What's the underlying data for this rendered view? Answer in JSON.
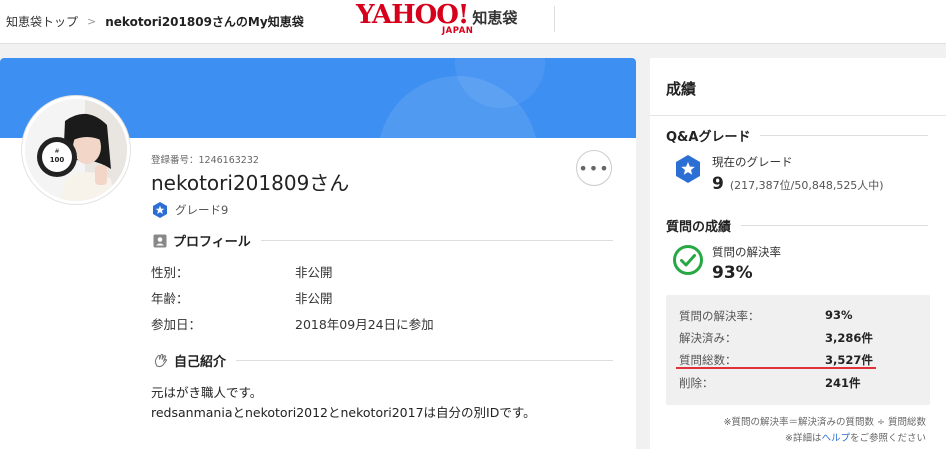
{
  "breadcrumb": {
    "top": "知恵袋トップ",
    "separator": ">",
    "current": "nekotori201809さんのMy知恵袋"
  },
  "logo": {
    "yahoo": "YAHOO!",
    "japan": "JAPAN",
    "service": "知恵袋",
    "brand_color": "#d7001c"
  },
  "profile": {
    "registration_label": "登録番号：1246163232",
    "username": "nekotori201809さん",
    "grade": "グレード9",
    "more_label": "•••",
    "avatar_icon": "avatar-photo",
    "banner_color": "#3d8ff1"
  },
  "profile_section": {
    "title": "プロフィール",
    "rows": [
      {
        "label": "性別：",
        "value": "非公開"
      },
      {
        "label": "年齢：",
        "value": "非公開"
      },
      {
        "label": "参加日：",
        "value": "2018年09月24日に参加"
      }
    ]
  },
  "intro_section": {
    "title": "自己紹介",
    "lines": [
      "元はがき職人です。",
      "redsanmaniaとnekotori2012とnekotori2017は自分の別IDです。"
    ]
  },
  "sidebar": {
    "title": "成績",
    "qa_grade": {
      "heading": "Q&Aグレード",
      "current_label": "現在のグレード",
      "value": "9",
      "rank": "(217,387位/50,848,525人中)",
      "badge_color": "#2b6ed4"
    },
    "question_stats": {
      "heading": "質問の成績",
      "rate_label": "質問の解決率",
      "rate_value": "93%",
      "check_color": "#27a844",
      "rows": [
        {
          "label": "質問の解決率：",
          "value": "93%"
        },
        {
          "label": "解決済み：",
          "value": "3,286件"
        },
        {
          "label": "質問総数：",
          "value": "3,527件"
        },
        {
          "label": "削除：",
          "value": "241件"
        }
      ],
      "highlight_color": "#e0303a"
    },
    "footnote1": "※質問の解決率＝解決済みの質問数 ÷ 質問総数",
    "footnote2_prefix": "※詳細は",
    "footnote2_link": "ヘルプ",
    "footnote2_suffix": "をご参照ください"
  }
}
